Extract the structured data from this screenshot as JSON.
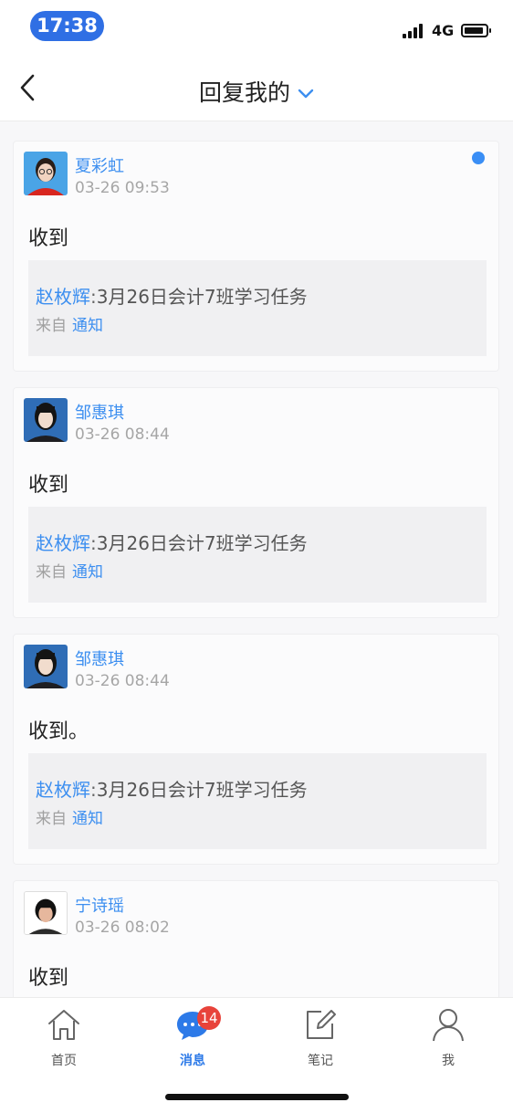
{
  "status_bar": {
    "time": "17:38",
    "network": "4G"
  },
  "header": {
    "title": "回复我的"
  },
  "replies": [
    {
      "user": "夏彩虹",
      "datetime": "03-26 09:53",
      "content": "收到",
      "unread": true,
      "quote": {
        "author": "赵枚辉",
        "sep": ":",
        "title": "3月26日会计7班学习任务",
        "source_label": "来自",
        "source_link": "通知"
      }
    },
    {
      "user": "邹惠琪",
      "datetime": "03-26 08:44",
      "content": "收到",
      "unread": false,
      "quote": {
        "author": "赵枚辉",
        "sep": ":",
        "title": "3月26日会计7班学习任务",
        "source_label": "来自",
        "source_link": "通知"
      }
    },
    {
      "user": "邹惠琪",
      "datetime": "03-26 08:44",
      "content": "收到。",
      "unread": false,
      "quote": {
        "author": "赵枚辉",
        "sep": ":",
        "title": "3月26日会计7班学习任务",
        "source_label": "来自",
        "source_link": "通知"
      }
    },
    {
      "user": "宁诗瑶",
      "datetime": "03-26 08:02",
      "content": "收到",
      "unread": false,
      "quote": {
        "author": "",
        "sep": "",
        "title": "",
        "source_label": "",
        "source_link": ""
      }
    }
  ],
  "tabbar": {
    "items": [
      {
        "label": "首页",
        "icon": "home-icon"
      },
      {
        "label": "消息",
        "icon": "message-icon",
        "badge": "14",
        "active": true
      },
      {
        "label": "笔记",
        "icon": "note-icon"
      },
      {
        "label": "我",
        "icon": "profile-icon"
      }
    ]
  },
  "colors": {
    "accent": "#3d8ff0",
    "badge": "#e8433b",
    "time_pill": "#2f6fe4"
  }
}
